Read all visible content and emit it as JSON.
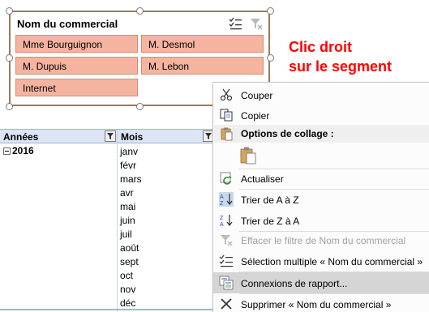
{
  "slicer": {
    "title": "Nom du commercial",
    "items": [
      {
        "label": "Mme Bourguignon"
      },
      {
        "label": "M. Desmol"
      },
      {
        "label": "M. Dupuis"
      },
      {
        "label": "M. Lebon"
      },
      {
        "label": "Internet"
      }
    ],
    "item_color": "#f4b4a0"
  },
  "annotation": {
    "line1": "Clic droit",
    "line2": "sur le segment",
    "color": "#ff0000"
  },
  "pivot": {
    "col1": "Années",
    "col2": "Mois",
    "year": "2016",
    "months": [
      "janv",
      "févr",
      "mars",
      "avr",
      "mai",
      "juin",
      "juil",
      "août",
      "sept",
      "oct",
      "nov",
      "déc"
    ]
  },
  "context_menu": {
    "cut": "Couper",
    "copy": "Copier",
    "paste_options": "Options de collage :",
    "refresh": "Actualiser",
    "sort_az": "Trier de A à Z",
    "sort_za": "Trier de Z à A",
    "clear_filter": "Effacer le filtre de Nom du commercial",
    "multi_select": "Sélection multiple « Nom du commercial »",
    "report_connections": "Connexions de rapport...",
    "delete": "Supprimer « Nom du commercial »"
  }
}
